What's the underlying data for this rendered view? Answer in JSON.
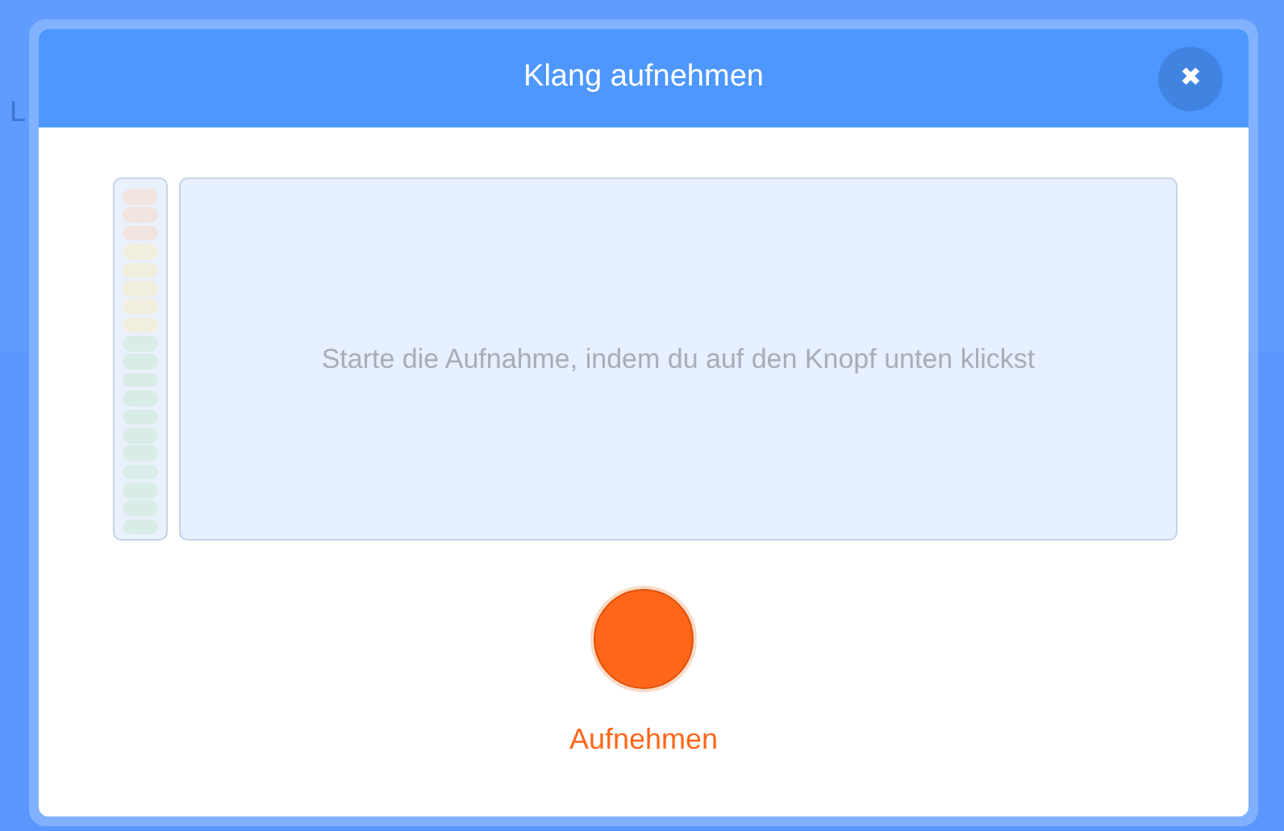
{
  "background": {
    "text": "L"
  },
  "dialog": {
    "title": "Klang aufnehmen",
    "close": "✖"
  },
  "meter": {
    "level": 0
  },
  "preview": {
    "message": "Starte die Aufnahme, indem du auf den Knopf unten klickst"
  },
  "record_button": {
    "label": "Aufnehmen"
  }
}
